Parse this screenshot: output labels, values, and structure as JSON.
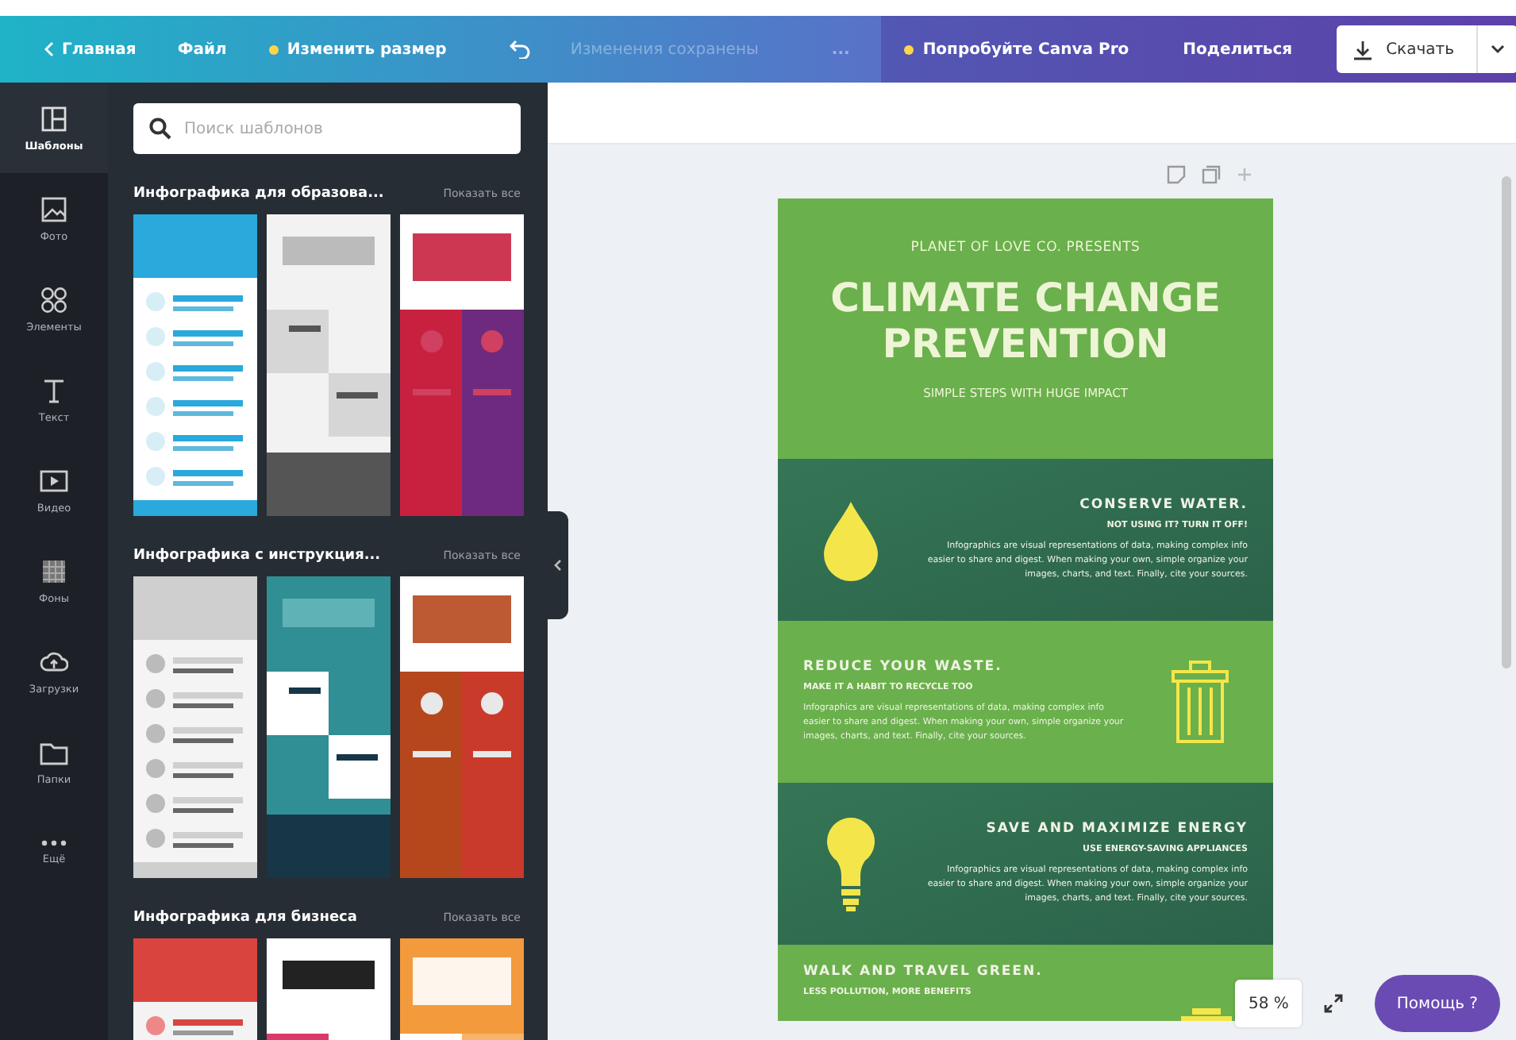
{
  "topbar": {
    "home": "Главная",
    "file": "Файл",
    "resize": "Изменить размер",
    "status": "Изменения сохранены",
    "more": "...",
    "pro": "Попробуйте Canva Pro",
    "share": "Поделиться",
    "download": "Скачать"
  },
  "sidebar": {
    "items": [
      {
        "label": "Шаблоны",
        "selected": true
      },
      {
        "label": "Фото",
        "selected": false
      },
      {
        "label": "Элементы",
        "selected": false
      },
      {
        "label": "Текст",
        "selected": false
      },
      {
        "label": "Видео",
        "selected": false
      },
      {
        "label": "Фоны",
        "selected": false
      },
      {
        "label": "Загрузки",
        "selected": false
      },
      {
        "label": "Папки",
        "selected": false
      },
      {
        "label": "Ещё",
        "selected": false
      }
    ]
  },
  "panel": {
    "search": {
      "placeholder": "Поиск шаблонов"
    },
    "sections": [
      {
        "title": "Инфографика для образова...",
        "link": "Показать все"
      },
      {
        "title": "Инфографика с инструкция...",
        "link": "Показать все"
      },
      {
        "title": "Инфографика для бизнеса",
        "link": "Показать все"
      }
    ]
  },
  "design": {
    "header": {
      "presenter": "PLANET OF LOVE CO. PRESENTS",
      "title": "CLIMATE CHANGE PREVENTION",
      "subtitle": "SIMPLE STEPS WITH HUGE IMPACT"
    },
    "tips": [
      {
        "kind": "dark",
        "title": "CONSERVE WATER.",
        "subtitle": "NOT USING IT? TURN IT OFF!",
        "body": "Infographics are visual representations of data, making complex info easier to share and digest. When making your own, simple organize your images, charts, and text. Finally, cite your sources."
      },
      {
        "kind": "light",
        "title": "REDUCE YOUR WASTE.",
        "subtitle": "MAKE IT A HABIT TO RECYCLE TOO",
        "body": "Infographics are visual representations of data, making complex info easier to share and digest. When making your own, simple organize your images, charts, and text. Finally, cite your sources."
      },
      {
        "kind": "dark",
        "title": "SAVE AND MAXIMIZE ENERGY",
        "subtitle": "USE ENERGY-SAVING APPLIANCES",
        "body": "Infographics are visual representations of data, making complex info easier to share and digest. When making your own, simple organize your images, charts, and text. Finally, cite your sources."
      },
      {
        "kind": "light",
        "title": "WALK AND TRAVEL GREEN.",
        "subtitle": "LESS POLLUTION, MORE BENEFITS"
      }
    ]
  },
  "zoom": "58 %",
  "help": "Помощь ?"
}
